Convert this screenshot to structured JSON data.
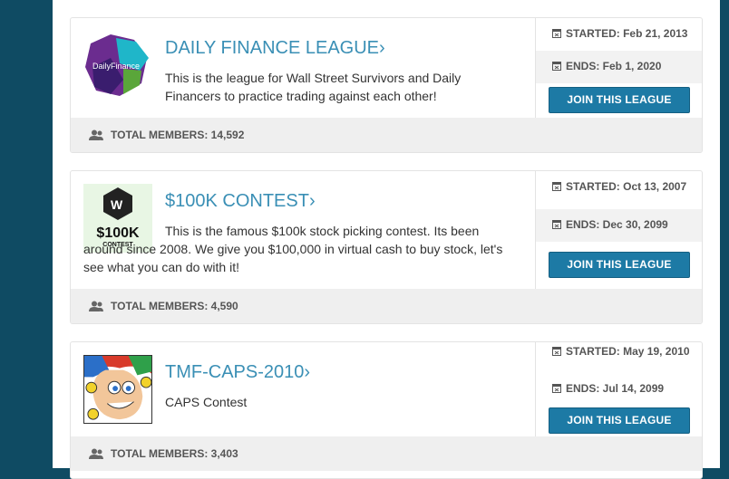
{
  "leagues": [
    {
      "title": "DAILY FINANCE LEAGUE›",
      "description": "This is the league for Wall Street Survivors and Daily Financers to practice trading against each other!",
      "logo_text": "DailyFinance",
      "started": "STARTED: Feb 21, 2013",
      "ends": "ENDS: Feb 1, 2020",
      "join_label": "JOIN THIS LEAGUE",
      "members": "TOTAL MEMBERS: 14,592"
    },
    {
      "title": "$100K CONTEST›",
      "description": "This is the famous $100k stock picking contest. Its been around since 2008. We give you $100,000 in virtual cash to buy stock, let's see what you can do with it!",
      "logo_text": "$100K",
      "logo_subtext": "CONTEST",
      "logo_mark": "W",
      "started": "STARTED: Oct 13, 2007",
      "ends": "ENDS: Dec 30, 2099",
      "join_label": "JOIN THIS LEAGUE",
      "members": "TOTAL MEMBERS: 4,590"
    },
    {
      "title": "TMF-CAPS-2010›",
      "description": "CAPS Contest",
      "started": "STARTED: May 19, 2010",
      "ends": "ENDS: Jul 14, 2099",
      "join_label": "JOIN THIS LEAGUE",
      "members": "TOTAL MEMBERS: 3,403"
    }
  ],
  "colors": {
    "page_bg": "#0f4b63",
    "title": "#3a8fb5",
    "button": "#1d7aa5",
    "footer_bg": "#efefef"
  },
  "icons": {
    "calendar": "calendar-icon",
    "members": "members-icon"
  }
}
